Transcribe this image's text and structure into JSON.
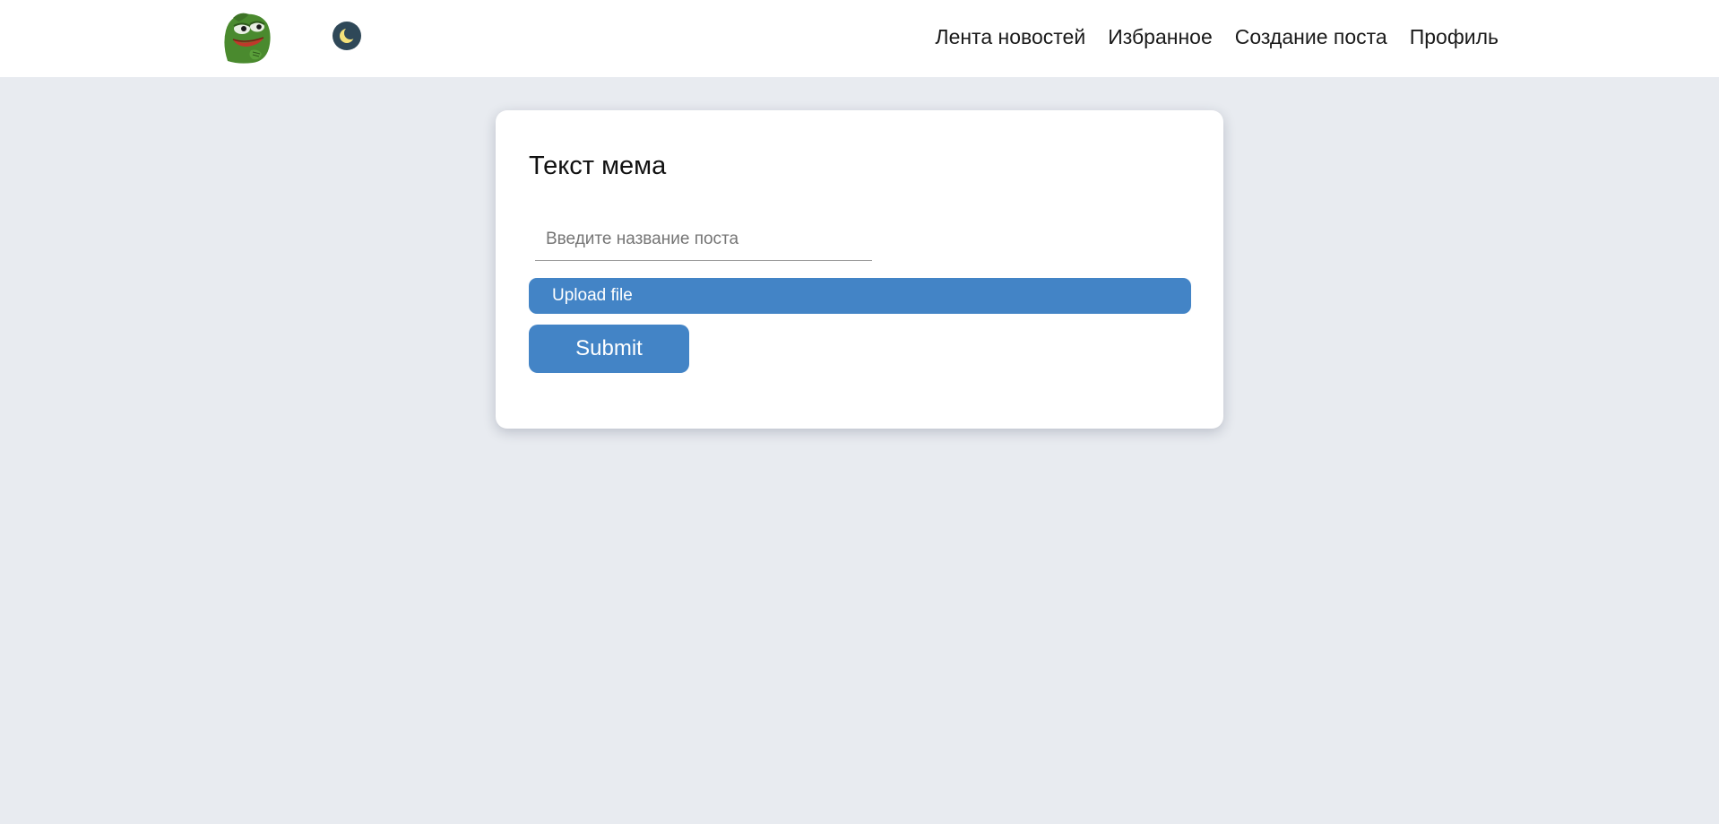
{
  "header": {
    "logo_icon": "pepe-frog-logo",
    "theme_toggle_icon": "moon-icon",
    "nav": [
      {
        "label": "Лента новостей"
      },
      {
        "label": "Избранное"
      },
      {
        "label": "Создание поста"
      },
      {
        "label": "Профиль"
      }
    ]
  },
  "form": {
    "title": "Текст мема",
    "post_name_placeholder": "Введите название поста",
    "post_name_value": "",
    "upload_label": "Upload file",
    "submit_label": "Submit"
  },
  "colors": {
    "page_background": "#e8ebf0",
    "accent": "#4384c6",
    "toggle_background": "#2f4858",
    "moon": "#f5e27a"
  }
}
